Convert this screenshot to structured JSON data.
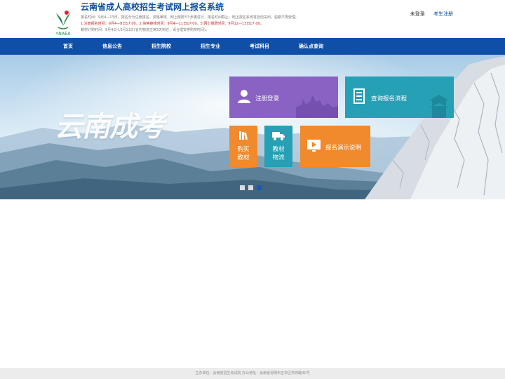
{
  "header": {
    "title": "云南省成人高校招生考试网上报名系统",
    "logo_text": "YNAEA",
    "notice_line1": "报名时间：9月4—13日。报名分为注册报名、资格审核、网上缴费3个步骤进行，报名时间截止，网上报名系统将自动关闭，逾期不再受理。",
    "notice_line2": "1.注册报名时间：9月4—8日17:00。2.资格审核时间：9月4—11日17:00。3.网上缴费时间：9月12—13日17:00。",
    "notice_line3": "教材订购时间：9月4日-10月11日(省内物流正常3天到达，请合理安排购买时间)。",
    "login_status": "未登录",
    "register_link": "考生注册"
  },
  "nav": {
    "items": [
      "首页",
      "信息公告",
      "招生院校",
      "招生专业",
      "考试科目",
      "确认点查询"
    ]
  },
  "banner": {
    "slogan": "云南成考",
    "tiles": {
      "login": "注册登录",
      "query": "查询报名流程",
      "buy_line1": "购买",
      "buy_line2": "教材",
      "logistics_line1": "教材",
      "logistics_line2": "物流",
      "demo": "报名演示说明"
    },
    "slide_count": 3,
    "active_slide": 3
  },
  "footer": {
    "text": "主办单位：云南省招生考试院 办公地址：云南省昆明市五华区学府路41号"
  },
  "colors": {
    "brand_blue": "#0f4fa8",
    "tile_purple": "#8a62c3",
    "tile_teal": "#25a0b4",
    "tile_orange": "#f08a2c",
    "notice_red": "#d21e1e"
  },
  "icons": [
    "ynaea-logo",
    "user-icon",
    "document-icon",
    "books-icon",
    "truck-icon",
    "play-icon"
  ]
}
